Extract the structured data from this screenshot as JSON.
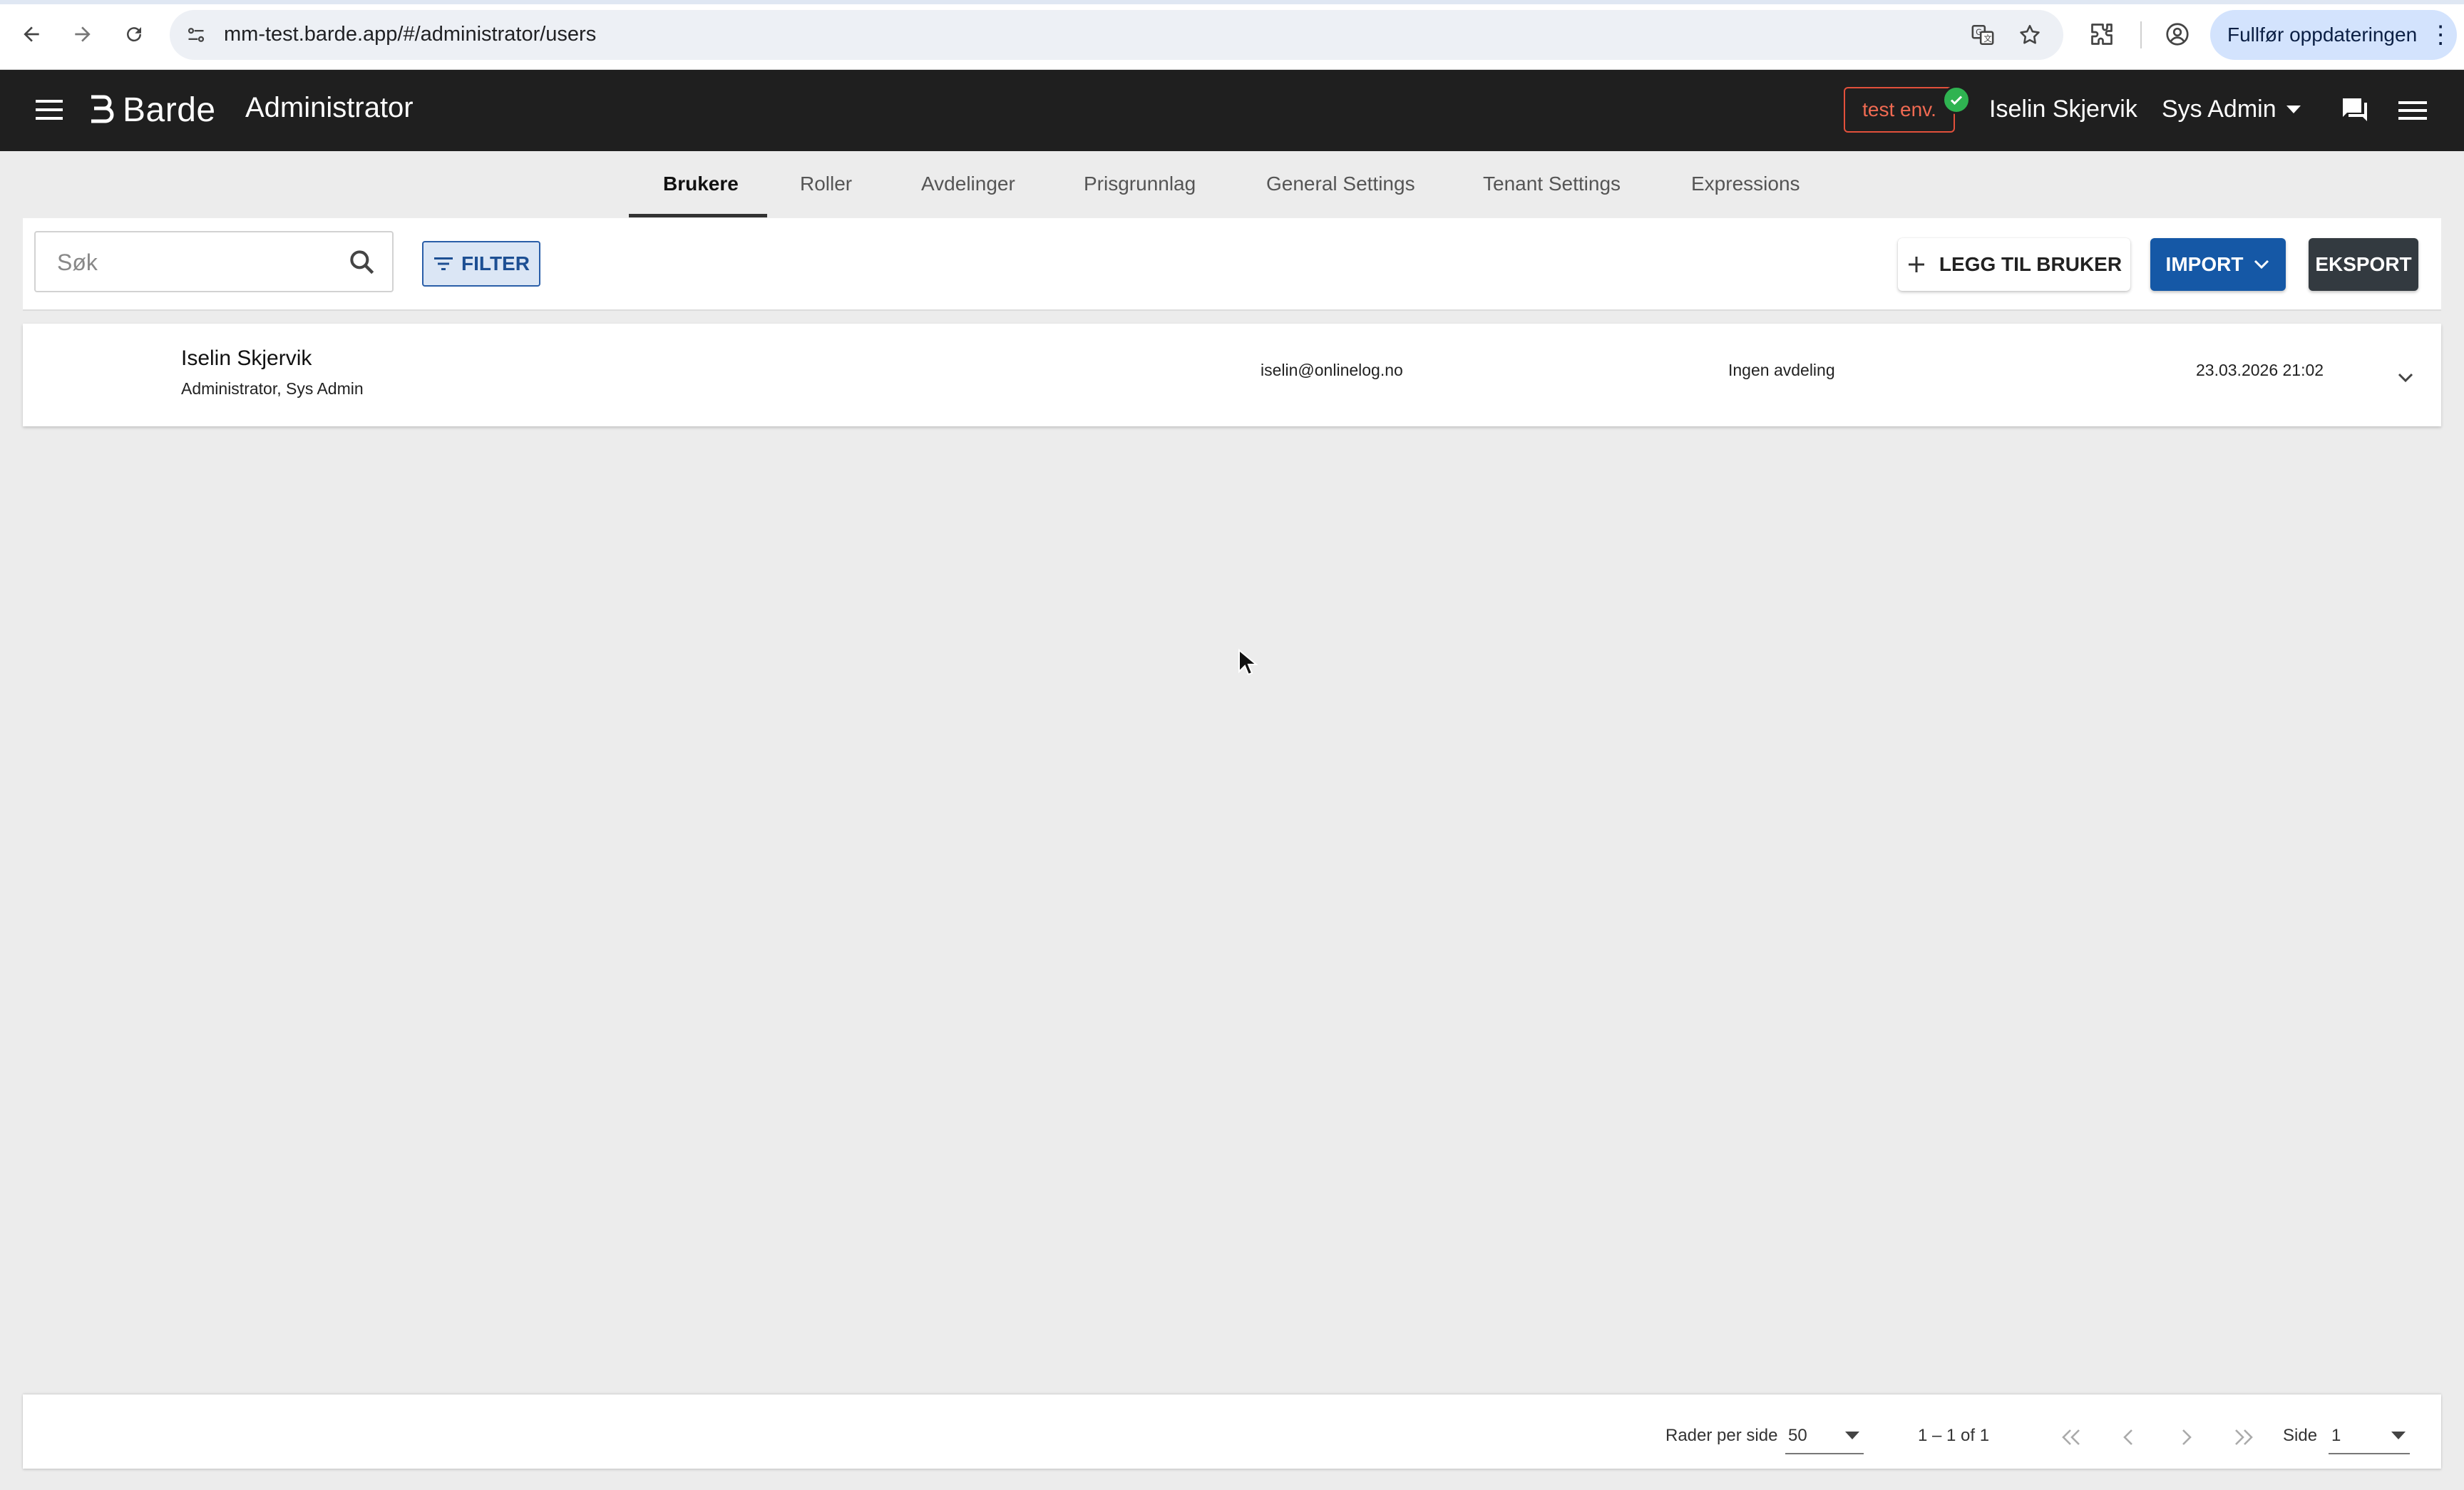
{
  "browser": {
    "url": "mm-test.barde.app/#/administrator/users",
    "update_button": "Fullfør oppdateringen"
  },
  "header": {
    "brand": "Barde",
    "title": "Administrator",
    "env_badge": "test env.",
    "user_name": "Iselin Skjervik",
    "role": "Sys Admin"
  },
  "tabs": [
    {
      "label": "Brukere",
      "active": true
    },
    {
      "label": "Roller"
    },
    {
      "label": "Avdelinger"
    },
    {
      "label": "Prisgrunnlag"
    },
    {
      "label": "General Settings"
    },
    {
      "label": "Tenant Settings"
    },
    {
      "label": "Expressions"
    }
  ],
  "toolbar": {
    "search_placeholder": "Søk",
    "filter_label": "FILTER",
    "add_user_label": "LEGG TIL BRUKER",
    "import_label": "IMPORT",
    "export_label": "EKSPORT"
  },
  "users": [
    {
      "name": "Iselin Skjervik",
      "roles": "Administrator, Sys Admin",
      "email": "iselin@onlinelog.no",
      "department": "Ingen avdeling",
      "last_login": "23.03.2026 21:02"
    }
  ],
  "paginator": {
    "rows_per_page_label": "Rader per side",
    "rows_per_page": "50",
    "range": "1 – 1 of 1",
    "page_label": "Side",
    "page": "1"
  },
  "colors": {
    "appbar": "#1f1f1f",
    "import_button": "#1558a6",
    "export_button": "#333a40",
    "env_badge": "#e2503b",
    "env_check": "#2fb351",
    "background": "#ececec"
  }
}
